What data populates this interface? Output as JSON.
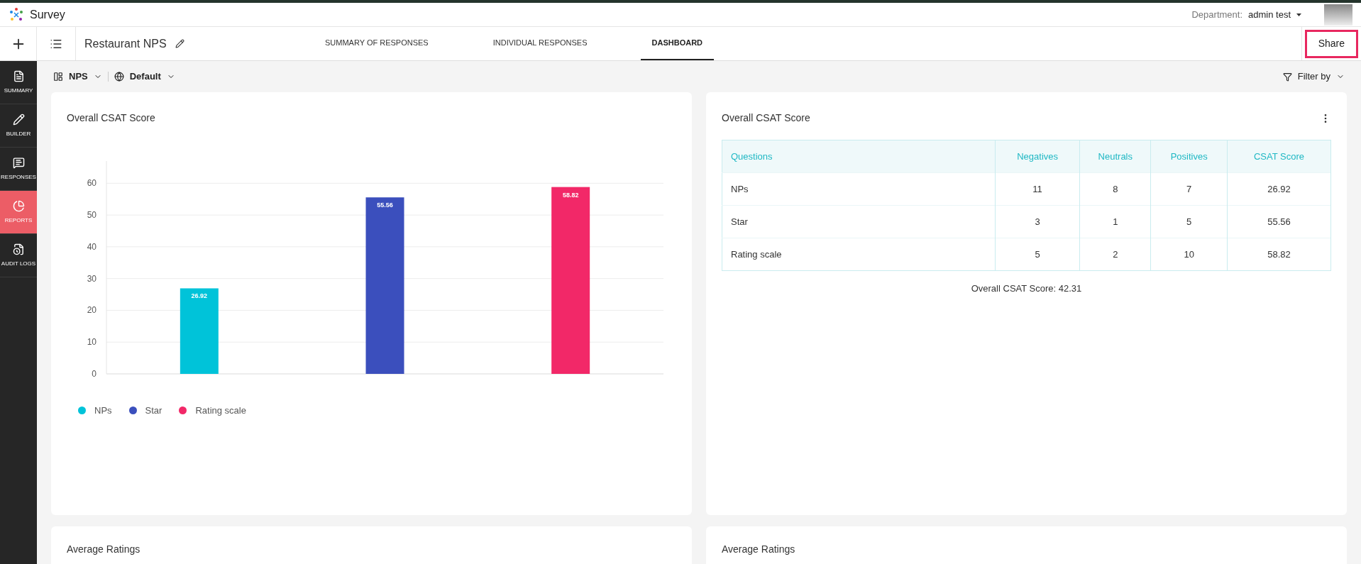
{
  "app": {
    "name": "Survey",
    "department_label": "Department:",
    "department": "admin test"
  },
  "survey": {
    "title": "Restaurant NPS"
  },
  "tabs": [
    {
      "label": "SUMMARY OF RESPONSES",
      "selected": false
    },
    {
      "label": "INDIVIDUAL RESPONSES",
      "selected": false
    },
    {
      "label": "DASHBOARD",
      "selected": true
    }
  ],
  "share_button": {
    "label": "Share",
    "highlighted": true
  },
  "sidebar": {
    "items": [
      {
        "label": "SUMMARY",
        "kind": "summary",
        "selected": false
      },
      {
        "label": "BUILDER",
        "kind": "builder",
        "selected": false
      },
      {
        "label": "RESPONSES",
        "kind": "responses",
        "selected": false
      },
      {
        "label": "REPORTS",
        "kind": "reports",
        "selected": true
      },
      {
        "label": "AUDIT LOGS",
        "kind": "audit",
        "selected": false
      }
    ]
  },
  "toolbar": {
    "view": "NPS",
    "language": "Default",
    "filter": "Filter by"
  },
  "chart_card": {
    "title": "Overall CSAT Score",
    "chart_data": {
      "type": "bar",
      "stacked": true,
      "grid": true,
      "series": [
        {
          "name": "NPs",
          "color": "#00c3d9",
          "values": [
            26.92,
            null,
            null
          ]
        },
        {
          "name": "Star",
          "color": "#3b4fbd",
          "values": [
            null,
            55.56,
            null
          ]
        },
        {
          "name": "Rating scale",
          "color": "#f22868",
          "values": [
            null,
            null,
            58.82
          ]
        }
      ],
      "ylim": [
        0,
        67
      ],
      "yticks": [
        0,
        10,
        20,
        30,
        40,
        50,
        60
      ],
      "data_labels": true,
      "legend": "bottom"
    }
  },
  "table_card": {
    "title": "Overall CSAT Score",
    "columns": [
      "Questions",
      "Negatives",
      "Neutrals",
      "Positives",
      "CSAT Score"
    ],
    "rows": [
      [
        "NPs",
        "11",
        "8",
        "7",
        "26.92"
      ],
      [
        "Star",
        "3",
        "1",
        "5",
        "55.56"
      ],
      [
        "Rating scale",
        "5",
        "2",
        "10",
        "58.82"
      ]
    ],
    "footer": "Overall CSAT Score: 42.31"
  },
  "bottom_cards": [
    {
      "title": "Average Ratings"
    },
    {
      "title": "Average Ratings"
    }
  ]
}
